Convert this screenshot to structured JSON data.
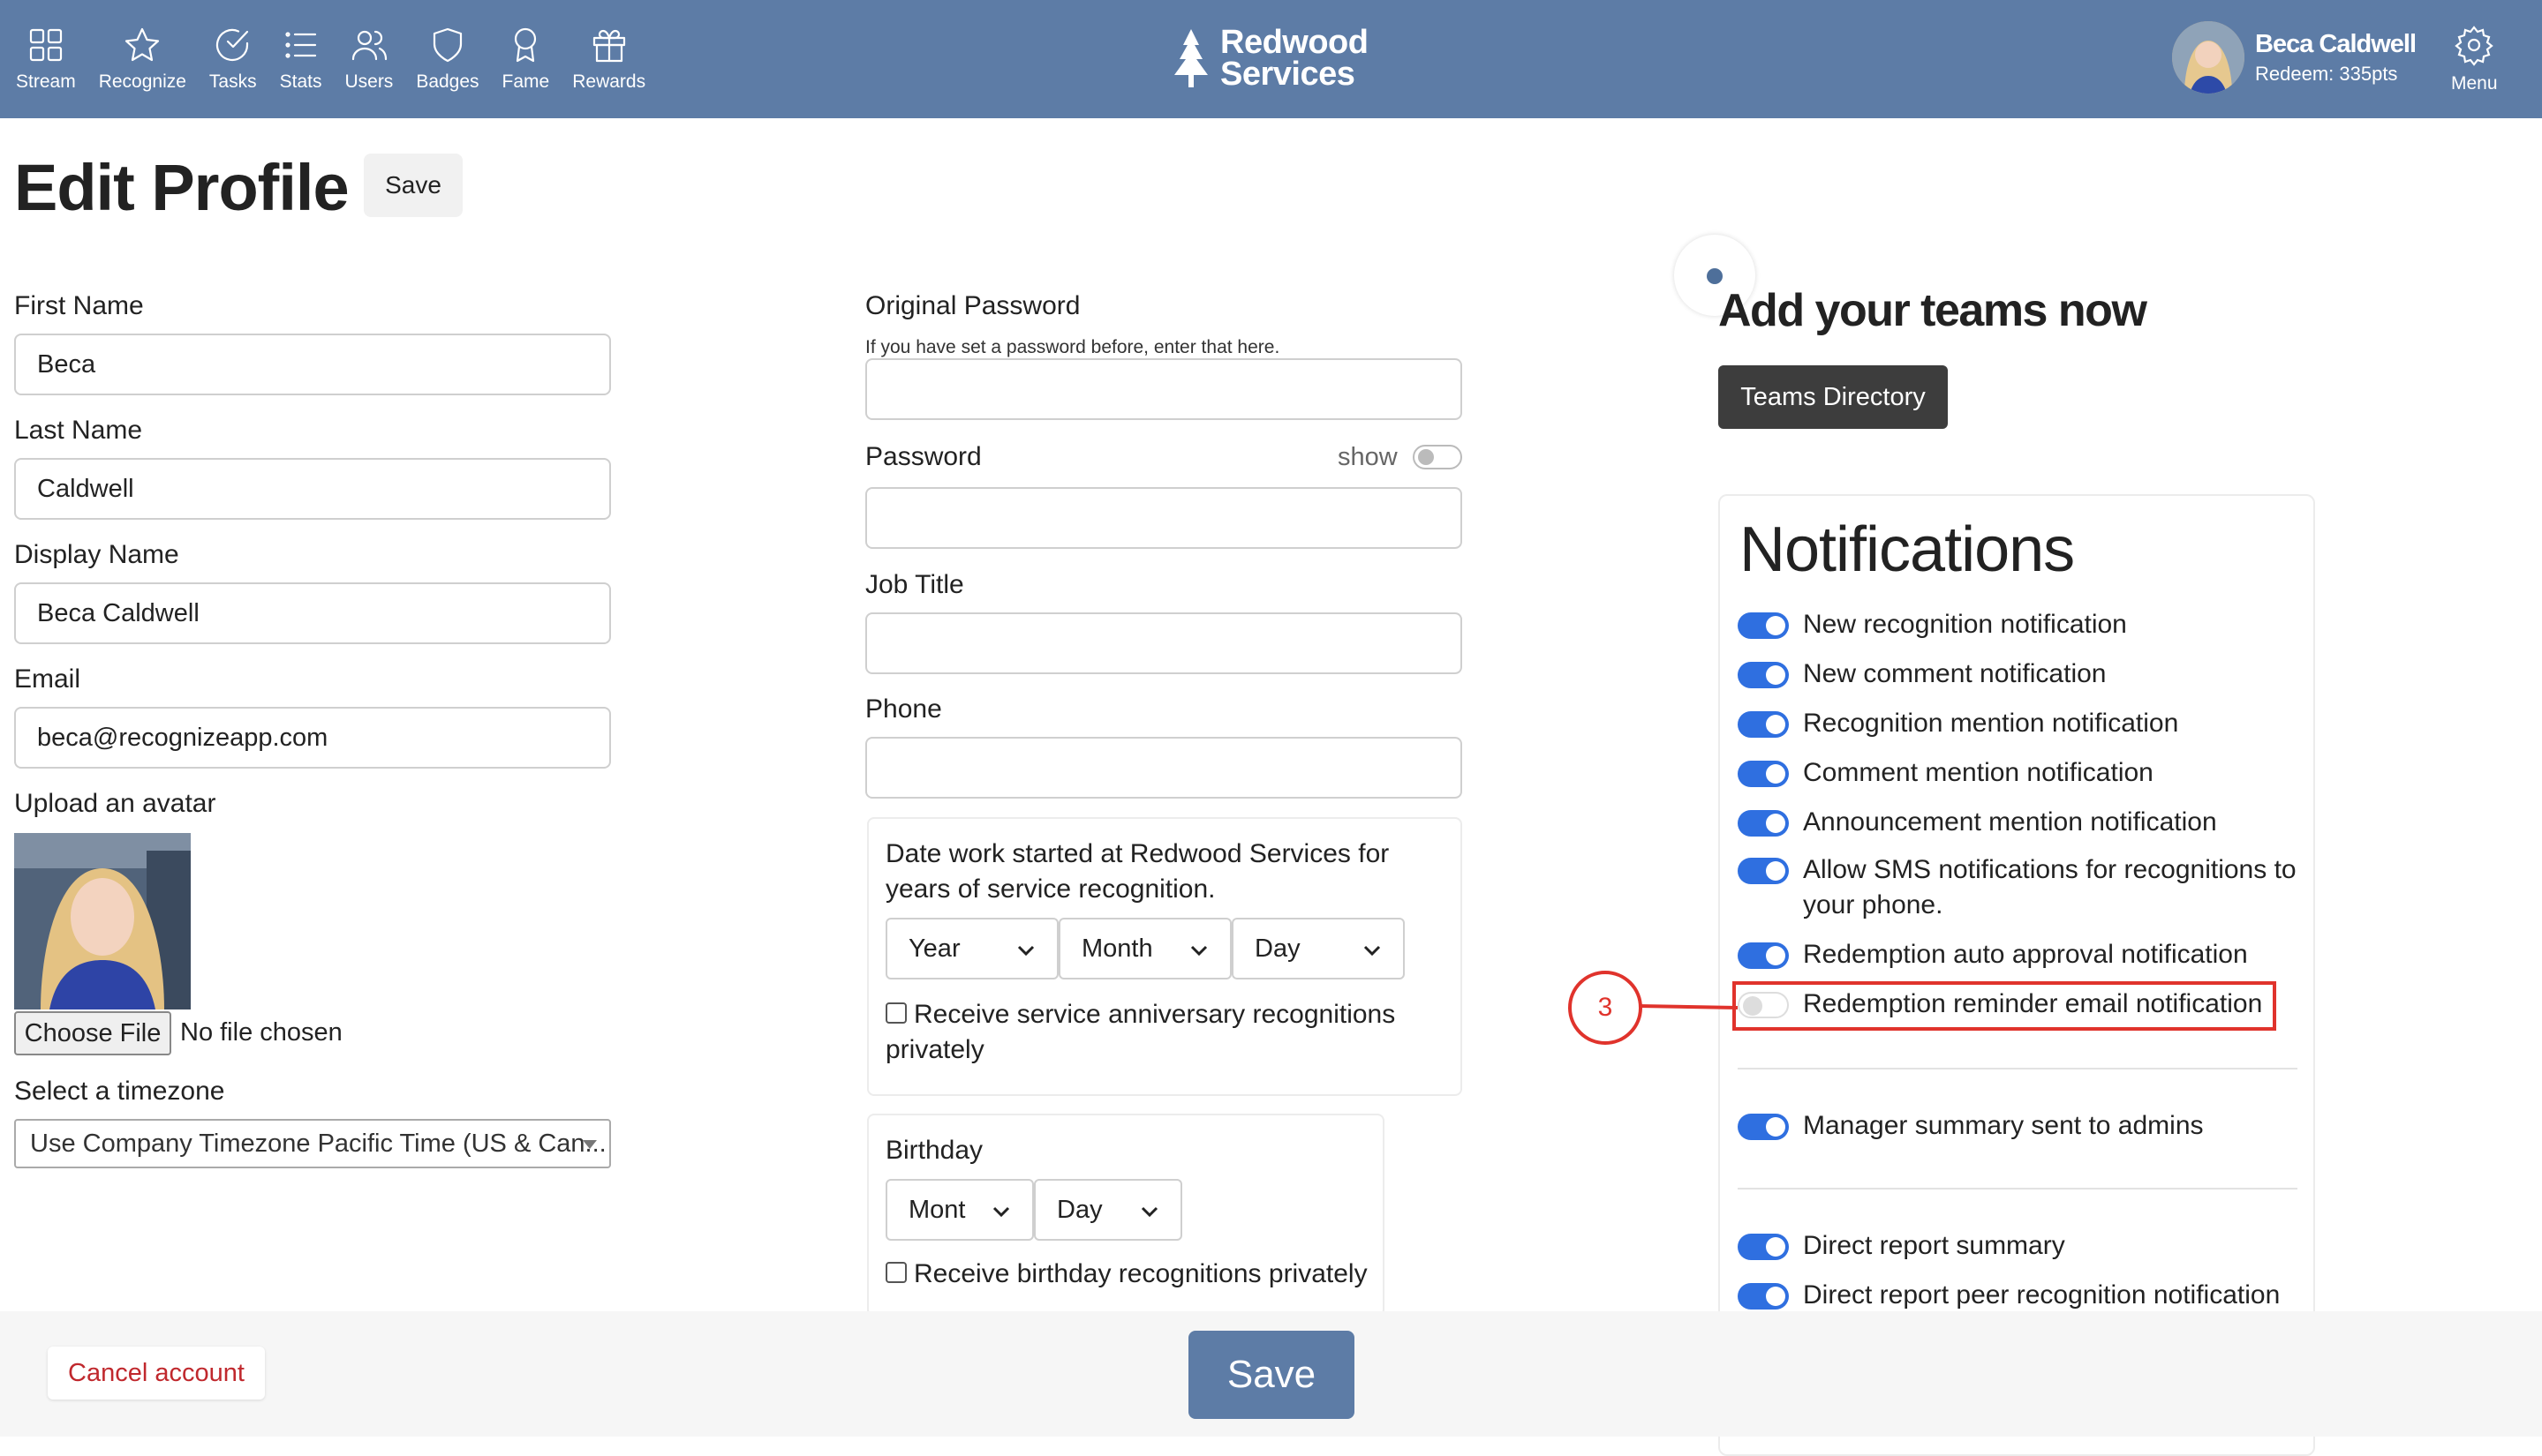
{
  "nav": {
    "items": [
      {
        "label": "Stream",
        "icon": "grid-icon"
      },
      {
        "label": "Recognize",
        "icon": "star-icon"
      },
      {
        "label": "Tasks",
        "icon": "check-circle-icon"
      },
      {
        "label": "Stats",
        "icon": "list-icon"
      },
      {
        "label": "Users",
        "icon": "users-icon"
      },
      {
        "label": "Badges",
        "icon": "shield-icon"
      },
      {
        "label": "Fame",
        "icon": "award-icon"
      },
      {
        "label": "Rewards",
        "icon": "gift-icon"
      }
    ],
    "brand_line1": "Redwood",
    "brand_line2": "Services",
    "user_name": "Beca Caldwell",
    "user_points": "Redeem: 335pts",
    "menu_label": "Menu"
  },
  "page": {
    "title": "Edit Profile",
    "save_top": "Save"
  },
  "profile": {
    "first_name_label": "First Name",
    "first_name": "Beca",
    "last_name_label": "Last Name",
    "last_name": "Caldwell",
    "display_name_label": "Display Name",
    "display_name": "Beca Caldwell",
    "email_label": "Email",
    "email": "beca@recognizeapp.com",
    "avatar_label": "Upload an avatar",
    "choose_file": "Choose File",
    "no_file": "No file chosen",
    "timezone_label": "Select a timezone",
    "timezone_value": "Use Company Timezone Pacific Time (US & Can..."
  },
  "account": {
    "orig_password_label": "Original Password",
    "orig_password_hint": "If you have set a password before, enter that here.",
    "password_label": "Password",
    "show_label": "show",
    "job_title_label": "Job Title",
    "phone_label": "Phone",
    "work_start_text": "Date work started at Redwood Services for years of service recognition.",
    "year_dd": "Year",
    "month_dd": "Month",
    "day_dd": "Day",
    "anniversary_private": "Receive service anniversary recognitions privately",
    "birthday_label": "Birthday",
    "bday_month_dd": "Mont",
    "bday_day_dd": "Day",
    "birthday_private": "Receive birthday recognitions privately"
  },
  "teams": {
    "title": "Add your teams now",
    "button": "Teams Directory"
  },
  "notifications": {
    "title": "Notifications",
    "items": [
      {
        "label": "New recognition notification",
        "on": true
      },
      {
        "label": "New comment notification",
        "on": true
      },
      {
        "label": "Recognition mention notification",
        "on": true
      },
      {
        "label": "Comment mention notification",
        "on": true
      },
      {
        "label": "Announcement mention notification",
        "on": true
      },
      {
        "label": "Allow SMS notifications for recognitions to your phone.",
        "on": true
      },
      {
        "label": "Redemption auto approval notification",
        "on": true
      },
      {
        "label": "Redemption reminder email notification",
        "on": false
      },
      {
        "label": "Manager summary sent to admins",
        "on": true
      },
      {
        "label": "Direct report summary",
        "on": true
      },
      {
        "label": "Direct report peer recognition notification",
        "on": true
      }
    ],
    "callout_number": "3"
  },
  "footer": {
    "cancel": "Cancel account",
    "save": "Save"
  },
  "colors": {
    "nav_bg": "#5d7ca6",
    "toggle_on": "#2f6fe0",
    "highlight": "#e0332c",
    "cancel_text": "#c0282d"
  }
}
